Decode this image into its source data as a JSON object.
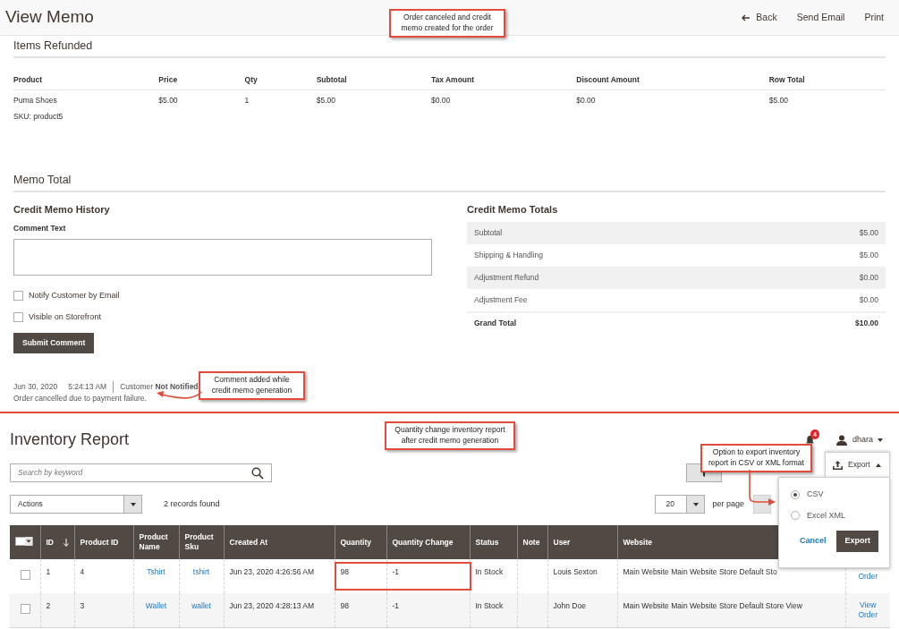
{
  "memo": {
    "title": "View Memo",
    "actions": [
      {
        "label": "Back",
        "kind": "back"
      },
      {
        "label": "Send Email",
        "kind": "plain"
      },
      {
        "label": "Print",
        "kind": "plain"
      }
    ],
    "items_title": "Items Refunded",
    "items_table": {
      "columns": [
        "Product",
        "Price",
        "Qty",
        "Subtotal",
        "Tax Amount",
        "Discount Amount",
        "Row Total"
      ],
      "rows": [
        {
          "cells": [
            "Puma Shoes",
            "$5.00",
            "1",
            "$5.00",
            "$0.00",
            "$0.00",
            "$5.00"
          ],
          "sku": "SKU: product5"
        }
      ]
    },
    "total_title": "Memo Total",
    "history": {
      "title": "Credit Memo History",
      "comment_label": "Comment Text",
      "options": [
        {
          "label": "Notify Customer by Email",
          "checked": false
        },
        {
          "label": "Visible on Storefront",
          "checked": false
        }
      ],
      "submit": "Submit Comment",
      "entries": [
        {
          "date": "Jun 30, 2020",
          "time": "5:24:13 AM",
          "customer": "Customer **Not Notified**",
          "text": "Order cancelled due to payment failure."
        }
      ]
    },
    "totals": {
      "title": "Credit Memo Totals",
      "rows": [
        {
          "label": "Subtotal",
          "value": "$5.00",
          "grand": false
        },
        {
          "label": "Shipping & Handling",
          "value": "$5.00",
          "grand": false
        },
        {
          "label": "Adjustment Refund",
          "value": "$0.00",
          "grand": false
        },
        {
          "label": "Adjustment Fee",
          "value": "$0.00",
          "grand": false
        },
        {
          "label": "Grand Total",
          "value": "$10.00",
          "grand": true
        }
      ]
    }
  },
  "inventory": {
    "title": "Inventory Report",
    "notifications": "4",
    "user": "dhara",
    "search": {
      "placeholder": "Search by keyword"
    },
    "actions_select": "Actions",
    "records": "2 records found",
    "per_page_value": "20",
    "per_page_label": "per page",
    "export": {
      "label": "Export",
      "expanded": true,
      "formats": [
        {
          "label": "CSV",
          "selected": true
        },
        {
          "label": "Excel XML",
          "selected": false
        }
      ],
      "cancel": "Cancel",
      "submit": "Export"
    },
    "table": {
      "mass_select": {
        "checked": false
      },
      "columns": [
        {
          "label": "ID",
          "sorted": true,
          "kind": "text"
        },
        {
          "label": "Product ID",
          "sorted": false,
          "kind": "text"
        },
        {
          "label": "Product Name",
          "sorted": false,
          "kind": "link"
        },
        {
          "label": "Product Sku",
          "sorted": false,
          "kind": "link"
        },
        {
          "label": "Created At",
          "sorted": false,
          "kind": "text"
        },
        {
          "label": "Quantity",
          "sorted": false,
          "kind": "text"
        },
        {
          "label": "Quantity Change",
          "sorted": false,
          "kind": "text"
        },
        {
          "label": "Status",
          "sorted": false,
          "kind": "text"
        },
        {
          "label": "Note",
          "sorted": false,
          "kind": "text"
        },
        {
          "label": "User",
          "sorted": false,
          "kind": "text"
        },
        {
          "label": "Website",
          "sorted": false,
          "kind": "text"
        }
      ],
      "rows": [
        {
          "selected": false,
          "cells": [
            "1",
            "4",
            "Tshirt",
            "tshirt",
            "Jun 23, 2020 4:26:56 AM",
            "98",
            "-1",
            "In Stock",
            null,
            "Louis Sexton",
            "Main Website Main Website Store Default Sto"
          ],
          "action": "Order",
          "highlighted": true
        },
        {
          "selected": false,
          "cells": [
            "2",
            "3",
            "Wallet",
            "wallet",
            "Jun 23, 2020 4:28:13 AM",
            "98",
            "-1",
            "In Stock",
            null,
            "John Doe",
            "Main Website Main Website Store Default Store View"
          ],
          "action": "View Order",
          "highlighted": false
        }
      ]
    }
  },
  "annotations": [
    {
      "text": "Order canceled and credit memo created for the order",
      "kind": "plain"
    },
    {
      "text": "Comment added while credit memo generation",
      "kind": "arrow-left"
    },
    {
      "text": "Quantity change inventory report after credit memo generation",
      "kind": "plain"
    },
    {
      "text": "Option to export inventory report in CSV or XML format",
      "kind": "arrow-down"
    }
  ]
}
